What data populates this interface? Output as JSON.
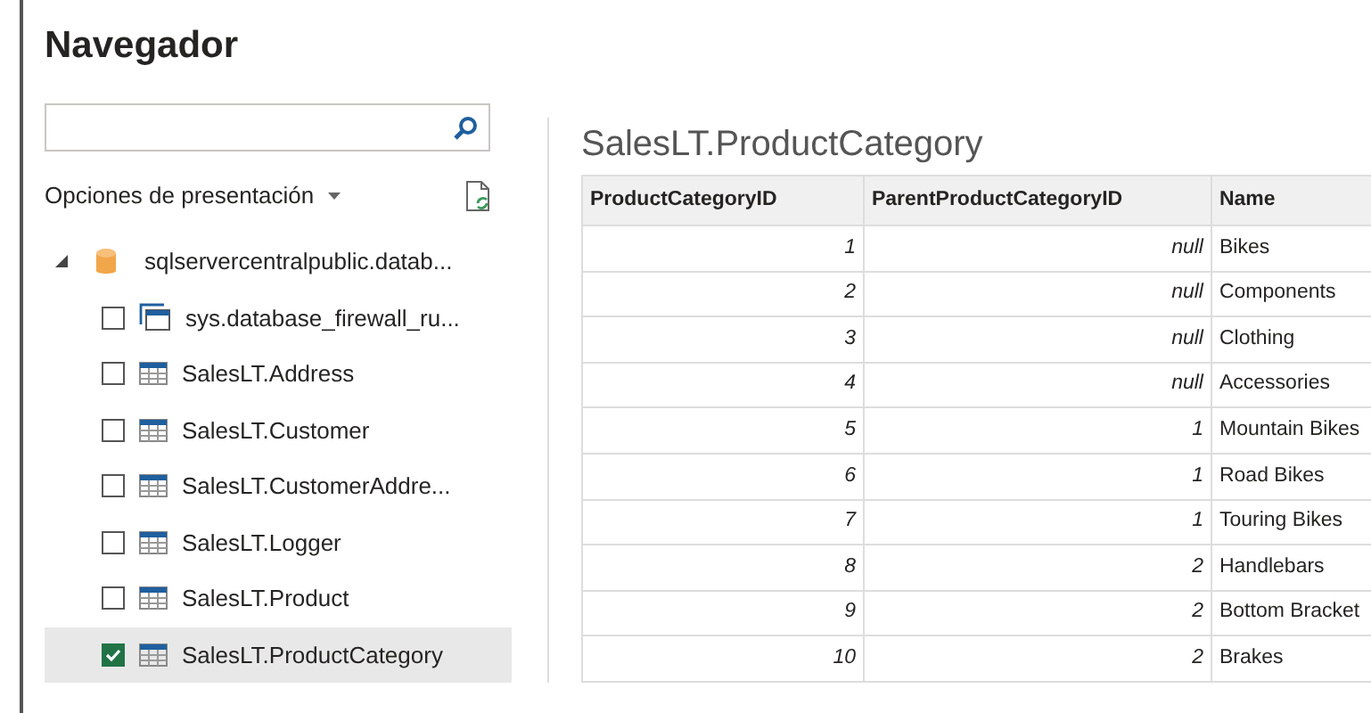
{
  "window": {
    "title": "Navegador"
  },
  "display_options": {
    "label": "Opciones de presentación"
  },
  "tree": {
    "label": "sqlservercentralpublic.datab...",
    "expanded": true,
    "children": [
      {
        "label": "sys.database_firewall_ru...",
        "kind": "view",
        "checked": false,
        "selected": false
      },
      {
        "label": "SalesLT.Address",
        "kind": "table",
        "checked": false,
        "selected": false
      },
      {
        "label": "SalesLT.Customer",
        "kind": "table",
        "checked": false,
        "selected": false
      },
      {
        "label": "SalesLT.CustomerAddre...",
        "kind": "table",
        "checked": false,
        "selected": false
      },
      {
        "label": "SalesLT.Logger",
        "kind": "table",
        "checked": false,
        "selected": false
      },
      {
        "label": "SalesLT.Product",
        "kind": "table",
        "checked": false,
        "selected": false
      },
      {
        "label": "SalesLT.ProductCategory",
        "kind": "table",
        "checked": true,
        "selected": true
      }
    ]
  },
  "preview": {
    "title": "SalesLT.ProductCategory",
    "table": {
      "columns": [
        "ProductCategoryID",
        "ParentProductCategoryID",
        "Name"
      ],
      "rows": [
        [
          "1",
          "null",
          "Bikes"
        ],
        [
          "2",
          "null",
          "Components"
        ],
        [
          "3",
          "null",
          "Clothing"
        ],
        [
          "4",
          "null",
          "Accessories"
        ],
        [
          "5",
          "1",
          "Mountain Bikes"
        ],
        [
          "6",
          "1",
          "Road Bikes"
        ],
        [
          "7",
          "1",
          "Touring Bikes"
        ],
        [
          "8",
          "2",
          "Handlebars"
        ],
        [
          "9",
          "2",
          "Bottom Bracket"
        ],
        [
          "10",
          "2",
          "Brakes"
        ]
      ]
    }
  }
}
